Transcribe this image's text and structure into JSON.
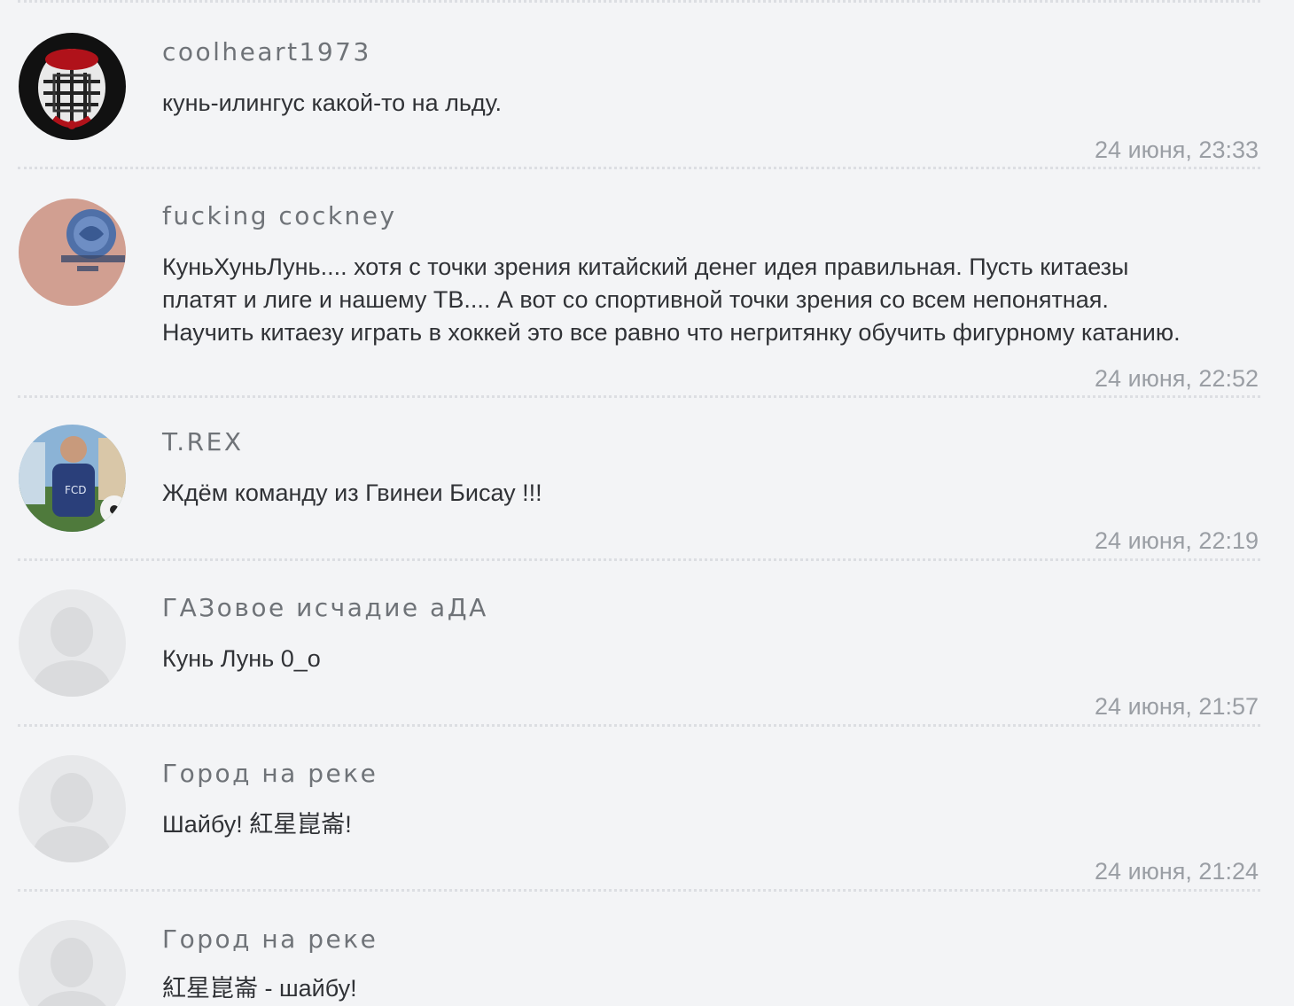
{
  "comments": [
    {
      "author": "coolheart1973",
      "text": "кунь-илингус какой-то на льду.",
      "time": "24 июня, 23:33",
      "avatar": "goalie-mask-avatar"
    },
    {
      "author": "fucking cockney",
      "text": "КуньХуньЛунь.... хотя с точки зрения китайский денег идея правильная. Пусть китаезы\nплатят и лиге и нашему ТВ.... А вот со спортивной точки зрения со всем непонятная.\nНаучить китаезу играть в хоккей это все равно что негритянку обучить фигурному катанию.",
      "time": "24 июня, 22:52",
      "avatar": "tattoo-avatar"
    },
    {
      "author": "T.REX",
      "text": "Ждём команду из Гвинеи Бисау !!!",
      "time": "24 июня, 22:19",
      "avatar": "user-photo-avatar"
    },
    {
      "author": "ГАЗовое исчадие аДА",
      "text": "Кунь Лунь 0_о",
      "time": "24 июня, 21:57",
      "avatar": "default-user-avatar"
    },
    {
      "author": "Город на реке",
      "text": "Шайбу! 紅星崑崙!",
      "time": "24 июня, 21:24",
      "avatar": "default-user-avatar"
    },
    {
      "author": "Город на реке",
      "text": "紅星崑崙 - шайбу!",
      "time": "",
      "avatar": "default-user-avatar"
    }
  ],
  "colors": {
    "background": "#f3f4f6",
    "author": "#6f7378",
    "text": "#303236",
    "time": "#9a9ea4",
    "separator": "#dcdee2"
  }
}
